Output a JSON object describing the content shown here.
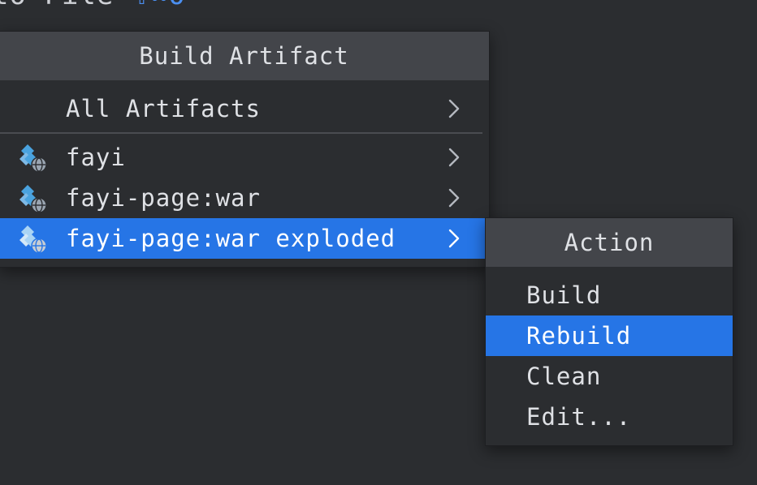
{
  "background": {
    "hint_text": "to File",
    "hint_shortcut": "⇧⌘O"
  },
  "build_artifact_popup": {
    "title": "Build Artifact",
    "items": [
      {
        "label": "All Artifacts",
        "has_submenu": true,
        "icon": null,
        "selected": false
      },
      {
        "label": "fayi",
        "has_submenu": true,
        "icon": "artifact-web-icon",
        "selected": false
      },
      {
        "label": "fayi-page:war",
        "has_submenu": true,
        "icon": "artifact-web-icon",
        "selected": false
      },
      {
        "label": "fayi-page:war exploded",
        "has_submenu": true,
        "icon": "artifact-web-icon",
        "selected": true
      }
    ]
  },
  "action_popup": {
    "title": "Action",
    "items": [
      {
        "label": "Build",
        "selected": false
      },
      {
        "label": "Rebuild",
        "selected": true
      },
      {
        "label": "Clean",
        "selected": false
      },
      {
        "label": "Edit...",
        "selected": false
      }
    ]
  },
  "colors": {
    "background": "#2b2d30",
    "header": "#43454a",
    "selection": "#2675e6",
    "shortcut": "#4b8ff0"
  }
}
